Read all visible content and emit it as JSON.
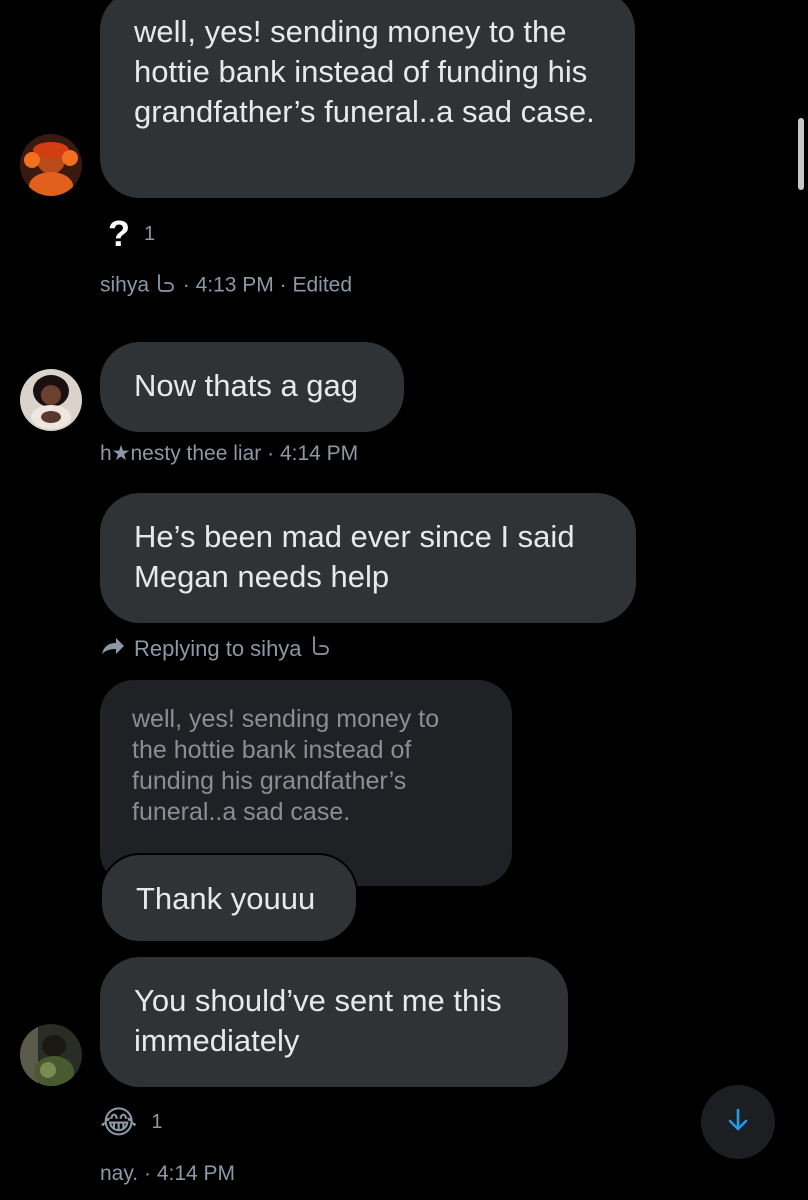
{
  "messages": [
    {
      "text": "well, yes! sending money to the hottie bank instead of funding his grandfather’s funeral..a sad case.",
      "reaction": {
        "emoji": "?",
        "count": "1"
      },
      "author": "sihya",
      "time": "4:13 PM",
      "edited": "Edited"
    },
    {
      "text": "Now thats a gag",
      "author": "h★nesty thee liar",
      "time": "4:14 PM"
    },
    {
      "text": "He’s been mad ever since I said Megan needs help"
    },
    {
      "reply_label": "Replying to sihya",
      "quoted_text": "well, yes! sending money to the hottie bank instead of funding his grandfather’s funeral..a sad case.",
      "text": "Thank youuu"
    },
    {
      "text": "You should’ve sent me this immediately",
      "reaction": {
        "emoji": "😂",
        "count": "1"
      },
      "author": "nay.",
      "time": "4:14 PM"
    }
  ],
  "separator": "·",
  "icons": {
    "hook": "hook-icon",
    "reply": "reply-arrow-icon",
    "scroll_down": "arrow-down-icon"
  },
  "colors": {
    "background": "#000000",
    "bubble": "#2f3336",
    "quoted_bubble": "#1f2124",
    "meta_text": "#8b98a5",
    "accent": "#1d9bf0"
  }
}
